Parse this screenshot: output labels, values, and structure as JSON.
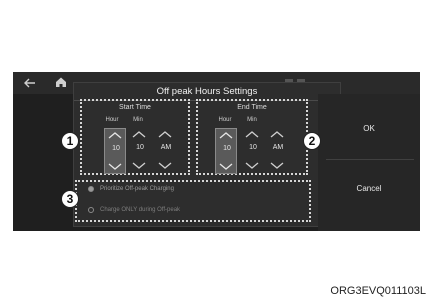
{
  "dialog": {
    "title": "Off peak Hours Settings",
    "ok_label": "OK",
    "cancel_label": "Cancel"
  },
  "start_time": {
    "title": "Start Time",
    "labels": {
      "hour": "Hour",
      "min": "Min"
    },
    "hour": "10",
    "min": "10",
    "ampm": "AM"
  },
  "end_time": {
    "title": "End Time",
    "labels": {
      "hour": "Hour",
      "min": "Min"
    },
    "hour": "10",
    "min": "10",
    "ampm": "AM"
  },
  "options": [
    {
      "label": "Prioritize Off-peak Charging",
      "selected": true
    },
    {
      "label": "Charge ONLY during Off-peak",
      "selected": false
    }
  ],
  "callouts": [
    "1",
    "2",
    "3"
  ],
  "caption": "ORG3EVQ011103L",
  "icons": [
    "back-arrow-icon",
    "home-icon",
    "chevron-up-icon",
    "chevron-down-icon"
  ],
  "colors": {
    "screen_bg": "#1f1f1f",
    "dialog_bg": "#2d2d2d",
    "selected_spin": "#5a5a5a"
  }
}
